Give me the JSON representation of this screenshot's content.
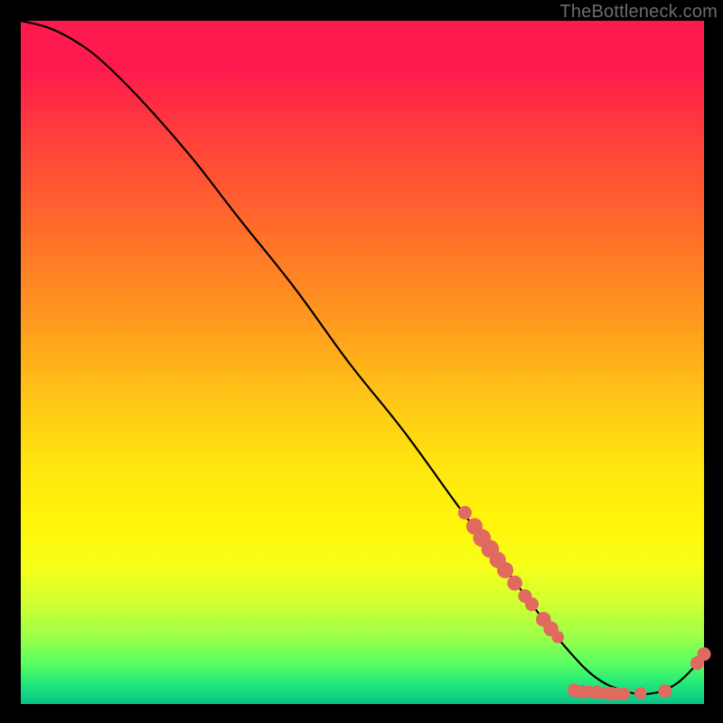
{
  "watermark": "TheBottleneck.com",
  "colors": {
    "dot": "#e06a5f",
    "curve": "#000000",
    "background_stops": [
      "#ff1a4d",
      "#ff9a1e",
      "#fff60a",
      "#0abf85"
    ]
  },
  "chart_data": {
    "type": "line",
    "title": "",
    "xlabel": "",
    "ylabel": "",
    "xlim": [
      0,
      100
    ],
    "ylim": [
      0,
      100
    ],
    "grid": false,
    "legend": false,
    "series": [
      {
        "name": "curve",
        "x": [
          0,
          4,
          8,
          12,
          18,
          25,
          32,
          40,
          48,
          56,
          64,
          70,
          76,
          80,
          84,
          88,
          92,
          96,
          100
        ],
        "y": [
          100,
          99,
          97,
          94,
          88,
          80,
          71,
          61,
          50,
          40,
          29,
          21,
          13,
          8,
          4,
          2,
          1.5,
          3,
          7
        ]
      }
    ],
    "scatter_points": {
      "name": "dots",
      "points": [
        {
          "x": 65.0,
          "y": 28.0,
          "r": 1.0
        },
        {
          "x": 66.4,
          "y": 26.0,
          "r": 1.2
        },
        {
          "x": 67.5,
          "y": 24.3,
          "r": 1.3
        },
        {
          "x": 68.7,
          "y": 22.7,
          "r": 1.3
        },
        {
          "x": 69.8,
          "y": 21.1,
          "r": 1.2
        },
        {
          "x": 70.9,
          "y": 19.6,
          "r": 1.2
        },
        {
          "x": 72.3,
          "y": 17.7,
          "r": 1.1
        },
        {
          "x": 73.8,
          "y": 15.8,
          "r": 1.0
        },
        {
          "x": 74.8,
          "y": 14.6,
          "r": 1.0
        },
        {
          "x": 76.5,
          "y": 12.4,
          "r": 1.1
        },
        {
          "x": 77.6,
          "y": 11.0,
          "r": 1.1
        },
        {
          "x": 78.6,
          "y": 9.8,
          "r": 0.9
        },
        {
          "x": 81.0,
          "y": 2.0,
          "r": 1.0
        },
        {
          "x": 82.2,
          "y": 1.8,
          "r": 1.0
        },
        {
          "x": 83.1,
          "y": 1.8,
          "r": 0.9
        },
        {
          "x": 84.3,
          "y": 1.7,
          "r": 1.0
        },
        {
          "x": 85.4,
          "y": 1.6,
          "r": 0.9
        },
        {
          "x": 86.5,
          "y": 1.5,
          "r": 1.0
        },
        {
          "x": 87.4,
          "y": 1.5,
          "r": 0.9
        },
        {
          "x": 88.3,
          "y": 1.5,
          "r": 0.9
        },
        {
          "x": 90.7,
          "y": 1.6,
          "r": 0.9
        },
        {
          "x": 94.3,
          "y": 1.9,
          "r": 1.0
        },
        {
          "x": 99.0,
          "y": 6.0,
          "r": 1.0
        },
        {
          "x": 100.0,
          "y": 7.3,
          "r": 1.0
        }
      ]
    }
  }
}
